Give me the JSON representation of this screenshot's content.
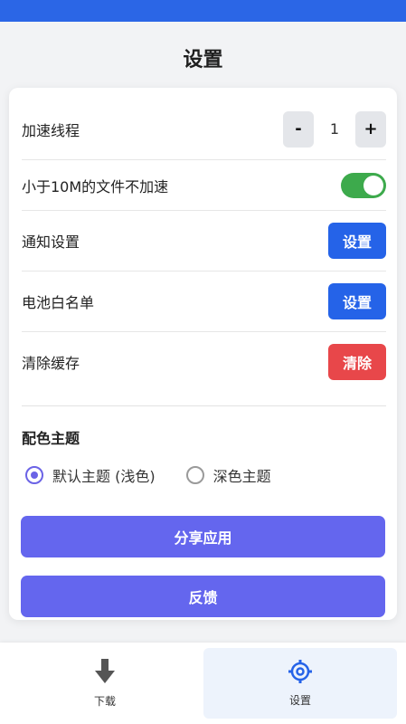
{
  "header": {
    "title": "设置"
  },
  "settings": {
    "accel_threads": {
      "label": "加速线程",
      "minus": "-",
      "value": "1",
      "plus": "+"
    },
    "small_file": {
      "label": "小于10M的文件不加速",
      "enabled": true
    },
    "notification": {
      "label": "通知设置",
      "button": "设置"
    },
    "battery": {
      "label": "电池白名单",
      "button": "设置"
    },
    "cache": {
      "label": "清除缓存",
      "button": "清除"
    }
  },
  "theme": {
    "title": "配色主题",
    "options": [
      {
        "label": "默认主题 (浅色)",
        "selected": true
      },
      {
        "label": "深色主题",
        "selected": false
      }
    ]
  },
  "actions": {
    "share": "分享应用",
    "feedback": "反馈"
  },
  "bottom_nav": {
    "download": {
      "label": "下载",
      "icon": "download-arrow-icon"
    },
    "settings": {
      "label": "设置",
      "icon": "gear-icon",
      "active": true
    }
  },
  "colors": {
    "top_bar": "#2b66e6",
    "primary_blue": "#2563e8",
    "danger_red": "#e8474a",
    "accent_purple": "#6466ee",
    "toggle_green": "#3daa4c"
  }
}
